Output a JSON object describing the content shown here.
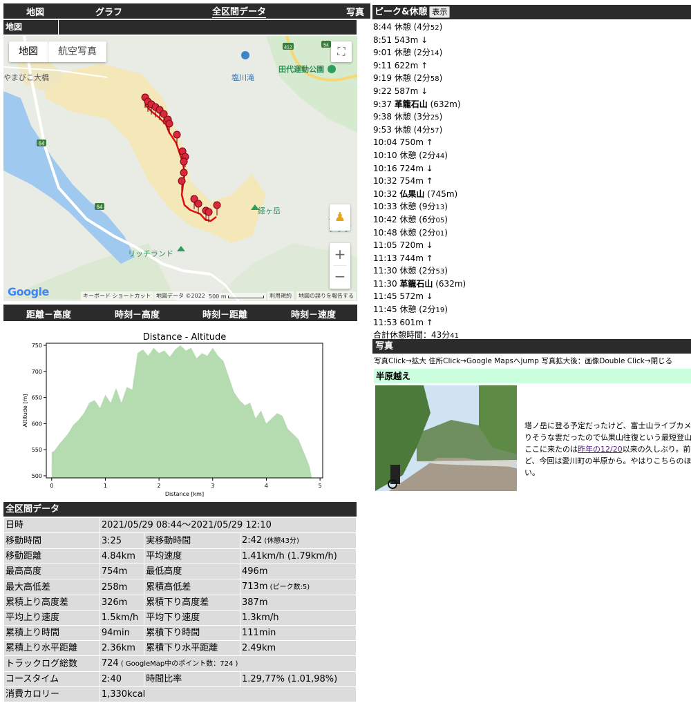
{
  "nav": {
    "map": "地図",
    "graph": "グラフ",
    "all_data": "全区間データ",
    "photo": "写真"
  },
  "map_section": {
    "label": "地図",
    "type_map": "地図",
    "type_aerial": "航空写真",
    "places": {
      "shiokawa": "塩川滝",
      "tashiro": "田代運動公園",
      "kyogatake": "経ヶ岳",
      "richland": "リッチランド",
      "mabiko": "やまびこ大橋",
      "club": "ナカウ\nクラブ"
    },
    "road_numbers": [
      "64",
      "64",
      "412",
      "54"
    ],
    "google": "Google",
    "attribution": {
      "keyboard": "キーボード ショートカット",
      "mapdata": "地図データ ©2022",
      "scale": "500 m",
      "terms": "利用規約",
      "report": "地図の誤りを報告する"
    }
  },
  "graph_tabs": [
    "距離－高度",
    "時刻－高度",
    "時刻－距離",
    "時刻－速度"
  ],
  "chart_data": {
    "type": "area",
    "title": "Distance - Altitude",
    "xlabel": "Distance [km]",
    "ylabel": "Altitude [m]",
    "xlim": [
      -0.1,
      5.05
    ],
    "ylim": [
      496,
      754
    ],
    "xticks": [
      0,
      1,
      2,
      3,
      4,
      5
    ],
    "yticks": [
      500,
      550,
      600,
      650,
      700,
      750
    ],
    "color": "#b5dbb0",
    "x": [
      0,
      0.05,
      0.1,
      0.15,
      0.2,
      0.3,
      0.4,
      0.5,
      0.6,
      0.7,
      0.8,
      0.9,
      1.0,
      1.1,
      1.2,
      1.3,
      1.4,
      1.5,
      1.6,
      1.7,
      1.8,
      1.9,
      2.0,
      2.1,
      2.2,
      2.3,
      2.4,
      2.5,
      2.6,
      2.7,
      2.8,
      2.9,
      3.0,
      3.1,
      3.2,
      3.3,
      3.4,
      3.5,
      3.6,
      3.7,
      3.8,
      3.9,
      4.0,
      4.1,
      4.2,
      4.3,
      4.4,
      4.5,
      4.6,
      4.7,
      4.8,
      4.84
    ],
    "y": [
      545,
      548,
      555,
      562,
      568,
      580,
      597,
      607,
      620,
      640,
      645,
      630,
      655,
      640,
      668,
      640,
      670,
      665,
      735,
      742,
      730,
      745,
      735,
      740,
      728,
      742,
      750,
      740,
      745,
      725,
      735,
      730,
      745,
      730,
      720,
      690,
      660,
      645,
      635,
      640,
      610,
      625,
      600,
      610,
      620,
      615,
      590,
      580,
      570,
      545,
      520,
      500
    ]
  },
  "summary": {
    "header": "全区間データ",
    "rows": [
      [
        "日時",
        "2021/05/29 08:44～2021/05/29 12:10"
      ],
      [
        "移動時間",
        "3:25",
        "実移動時間",
        "2:42",
        "(休憩43分)"
      ],
      [
        "移動距離",
        "4.84km",
        "平均速度",
        "1.41km/h (1.79km/h)"
      ],
      [
        "最高高度",
        "754m",
        "最低高度",
        "496m"
      ],
      [
        "最大高低差",
        "258m",
        "累積高低差",
        "713m",
        "(ピーク数:5)"
      ],
      [
        "累積上り高度差",
        "326m",
        "累積下り高度差",
        "387m"
      ],
      [
        "平均上り速度",
        "1.5km/h",
        "平均下り速度",
        "1.3km/h"
      ],
      [
        "累積上り時間",
        "94min",
        "累積下り時間",
        "111min"
      ],
      [
        "累積上り水平距離",
        "2.36km",
        "累積下り水平距離",
        "2.49km"
      ],
      [
        "トラックログ総数",
        "724",
        "( GoogleMap中のポイント数：724 )"
      ],
      [
        "コースタイム",
        "2:40",
        "時間比率",
        "1.29,77% (1.01,98%)"
      ],
      [
        "消費カロリー",
        "1,330kcal"
      ]
    ]
  },
  "peaks": {
    "title": "ピーク&休憩",
    "show_button": "表示",
    "items": [
      [
        "8:44 休憩 (4分",
        "52",
        ")"
      ],
      [
        "8:51 543m ↓"
      ],
      [
        "9:01 休憩 (2分",
        "14",
        ")"
      ],
      [
        "9:11 622m ↑"
      ],
      [
        "9:19 休憩 (2分",
        "58",
        ")"
      ],
      [
        "9:22 587m ↓"
      ],
      [
        "9:37 ",
        "B:革籠石山",
        " (632m)"
      ],
      [
        "9:38 休憩 (3分",
        "25",
        ")"
      ],
      [
        "9:53 休憩 (4分",
        "57",
        ")"
      ],
      [
        "10:04 750m ↑"
      ],
      [
        "10:10 休憩 (2分",
        "44",
        ")"
      ],
      [
        "10:16 724m ↓"
      ],
      [
        "10:32 754m ↑"
      ],
      [
        "10:32 ",
        "B:仏果山",
        " (745m)"
      ],
      [
        "10:33 休憩 (9分",
        "13",
        ")"
      ],
      [
        "10:42 休憩 (6分",
        "05",
        ")"
      ],
      [
        "10:48 休憩 (2分",
        "01",
        ")"
      ],
      [
        "11:05 720m ↓"
      ],
      [
        "11:13 744m ↑"
      ],
      [
        "11:30 休憩 (2分",
        "53",
        ")"
      ],
      [
        "11:30 ",
        "B:革籠石山",
        " (632m)"
      ],
      [
        "11:45 572m ↓"
      ],
      [
        "11:45 休憩 (2分",
        "19",
        ")"
      ],
      [
        "11:53 601m ↑"
      ],
      [
        "合計休憩時間：43分",
        "41",
        ""
      ]
    ]
  },
  "photos": {
    "header": "写真",
    "hint": "写真Click→拡大 住所Click→Google Mapsへjump 写真拡大後：画像Double Click→閉じる",
    "item_title": "半原越え",
    "text_lines": [
      "塔ノ岳に登る予定だったけど、富士山ライブカメラ",
      "りそうな雲だったので仏果山往復という最短登山。"
    ],
    "line3_pre": "ここに来たのは",
    "line3_link": "昨年の12/20",
    "line3_post": "以来の久しぶり。前回",
    "line4": "ど、今回は愛川町の半原から。やはりこちらのほう",
    "line5": "い。"
  }
}
